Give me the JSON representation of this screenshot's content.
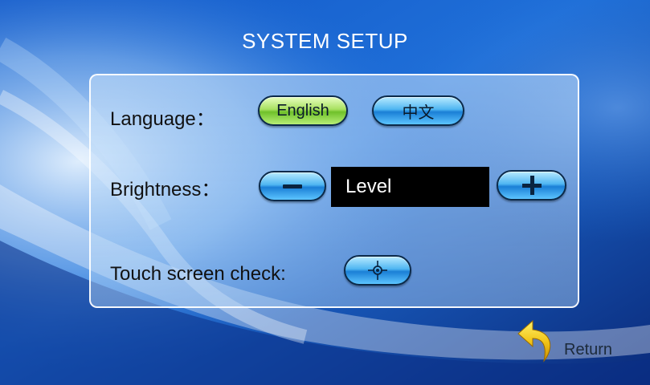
{
  "header": {
    "title": "SYSTEM SETUP"
  },
  "language": {
    "label": "Language：",
    "options": [
      "English",
      "中文"
    ],
    "selected": "English"
  },
  "brightness": {
    "label": "Brightness：",
    "decrease_icon": "minus-icon",
    "increase_icon": "plus-icon",
    "level_text": "Level"
  },
  "touch": {
    "label": "Touch screen check:",
    "icon": "crosshair-icon"
  },
  "footer": {
    "return_label": "Return",
    "return_icon": "return-arrow-icon"
  },
  "colors": {
    "background": "#0a2a88",
    "button_blue": "#3fa8ee",
    "button_selected_green": "#8fd64a",
    "level_box": "#000000",
    "return_arrow": "#e8b800"
  }
}
